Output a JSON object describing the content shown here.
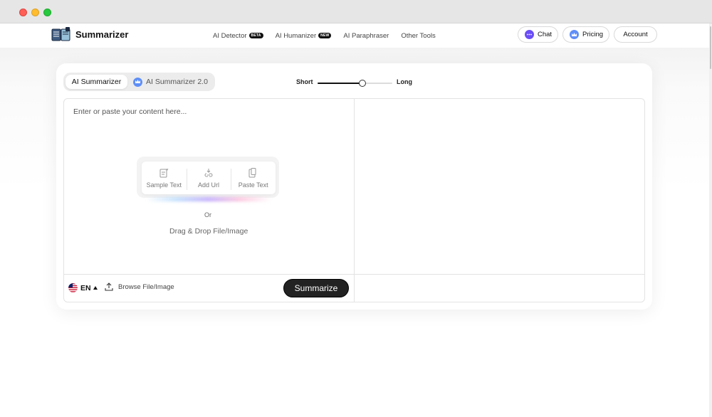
{
  "window": {
    "controls": [
      "close",
      "minimize",
      "maximize"
    ]
  },
  "nav": {
    "logo_icon": "book-logo-icon",
    "logo_text": "Summarizer",
    "links": [
      {
        "label": "AI Detector",
        "badge": "BETA"
      },
      {
        "label": "AI Humanizer",
        "badge": "NEW"
      },
      {
        "label": "AI Paraphraser",
        "badge": ""
      },
      {
        "label": "Other Tools",
        "badge": ""
      }
    ],
    "chat_label": "Chat",
    "pricing_label": "Pricing",
    "account_label": "Account"
  },
  "tool": {
    "tabs": [
      {
        "label": "AI Summarizer",
        "active": true
      },
      {
        "label": "AI Summarizer 2.0",
        "active": false,
        "icon": "crown-icon"
      }
    ],
    "length": {
      "short_label": "Short",
      "long_label": "Long",
      "value": 0.6
    },
    "input": {
      "placeholder": "Enter or paste your content here...",
      "actions": [
        {
          "label": "Sample Text",
          "icon": "sample-text-icon"
        },
        {
          "label": "Add Url",
          "icon": "link-icon"
        },
        {
          "label": "Paste Text",
          "icon": "clipboard-icon"
        }
      ],
      "or_label": "Or",
      "drag_label": "Drag & Drop File/Image"
    },
    "footer": {
      "language": "EN",
      "flag_icon": "us-flag-icon",
      "browse_label": "Browse File/Image",
      "summarize_label": "Summarize"
    }
  },
  "colors": {
    "accent": "#222222",
    "chat": "#6b4ef6",
    "pricing": "#5f8ff7"
  }
}
